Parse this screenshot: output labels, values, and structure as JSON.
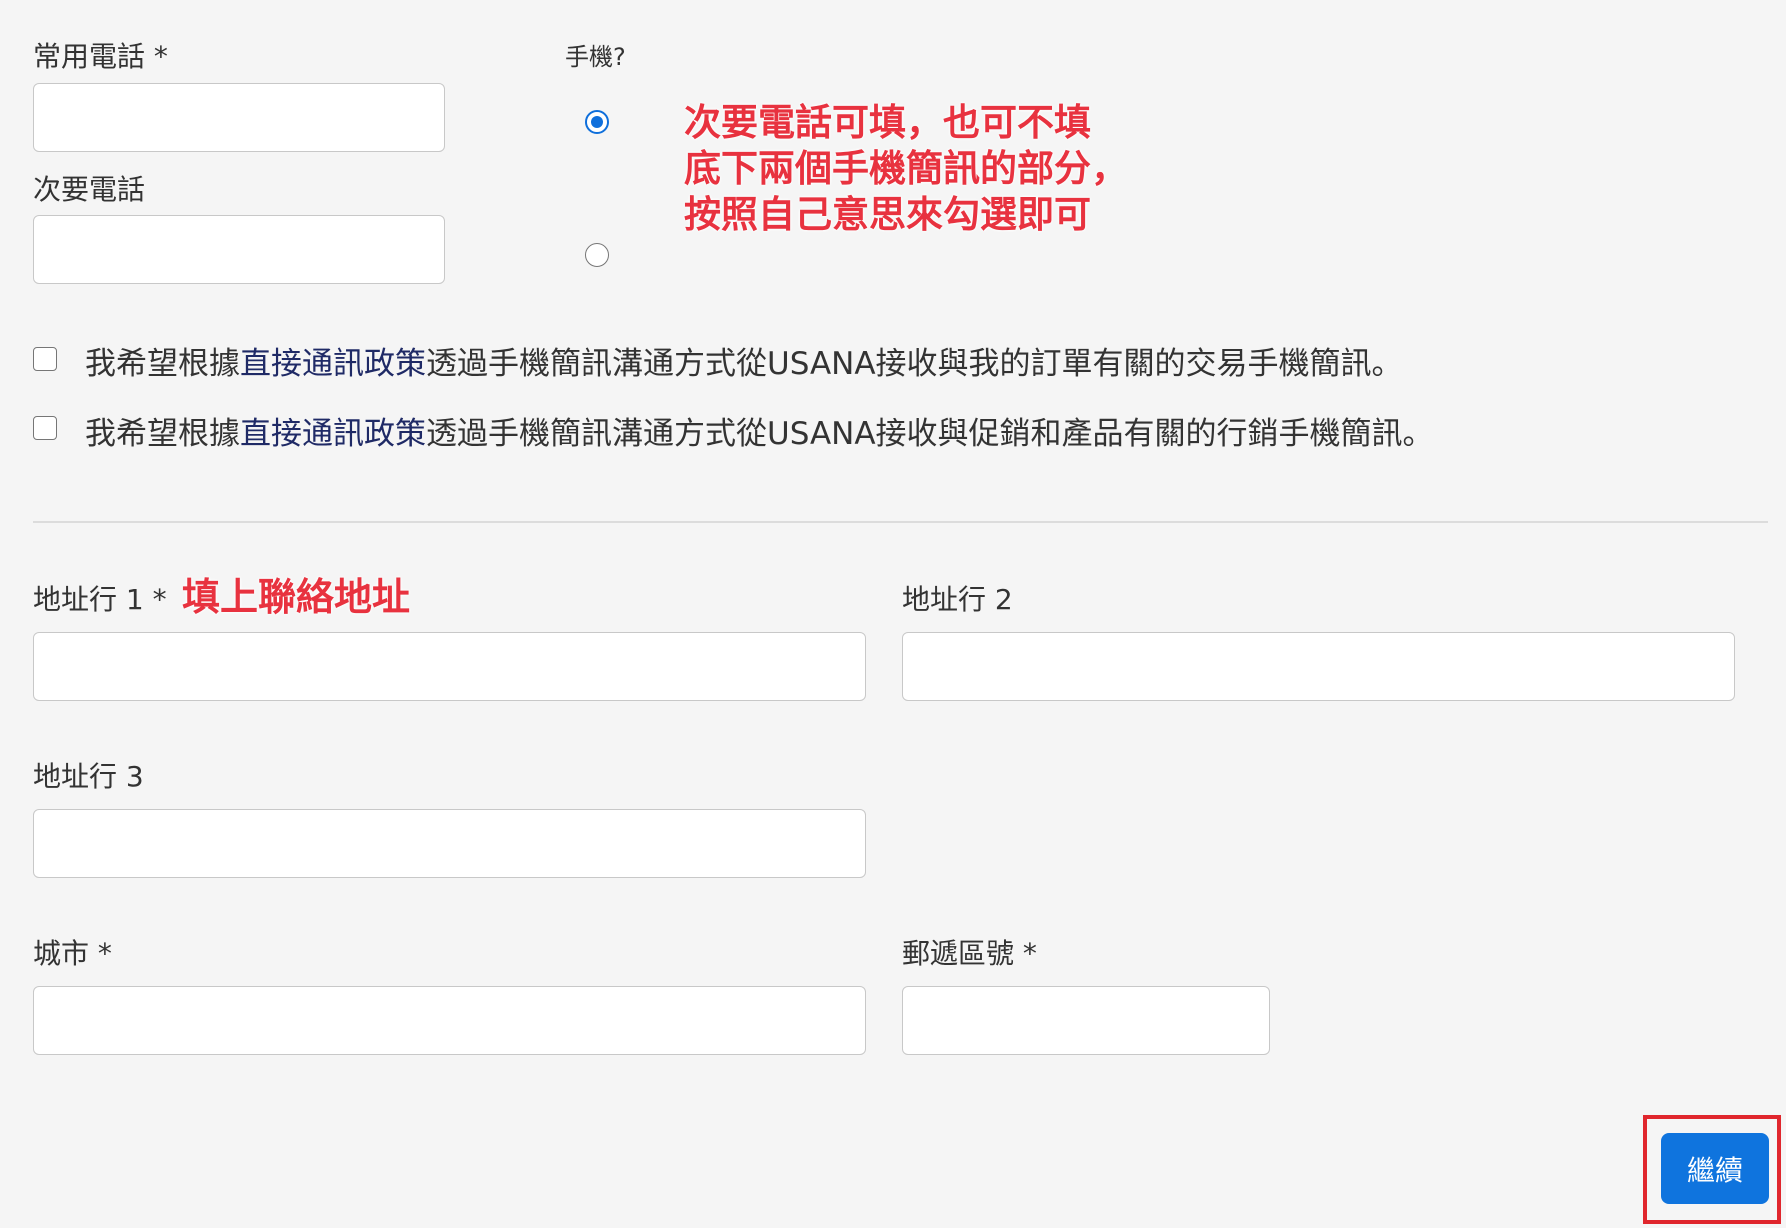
{
  "phone": {
    "primary_label": "常用電話 *",
    "primary_value": "",
    "secondary_label": "次要電話",
    "secondary_value": "",
    "mobile_label": "手機?"
  },
  "note_phone": {
    "line1": "次要電話可填，也可不填",
    "line2": "底下兩個手機簡訊的部分，",
    "line3": "按照自己意思來勾選即可"
  },
  "consents": [
    {
      "prefix": "我希望根據",
      "link": "直接通訊政策",
      "suffix": "透過手機簡訊溝通方式從USANA接收與我的訂單有關的交易手機簡訊。",
      "checked": false
    },
    {
      "prefix": "我希望根據",
      "link": "直接通訊政策",
      "suffix": "透過手機簡訊溝通方式從USANA接收與促銷和產品有關的行銷手機簡訊。",
      "checked": false
    }
  ],
  "address": {
    "line1_label": "地址行 1 *",
    "line1_note": "填上聯絡地址",
    "line2_label": "地址行 2",
    "line3_label": "地址行 3",
    "city_label": "城市 *",
    "postal_label": "郵遞區號 *"
  },
  "continue_label": "繼續",
  "colors": {
    "accent": "#0f74de",
    "annotation": "#e8323f",
    "link": "#1f2a66"
  }
}
